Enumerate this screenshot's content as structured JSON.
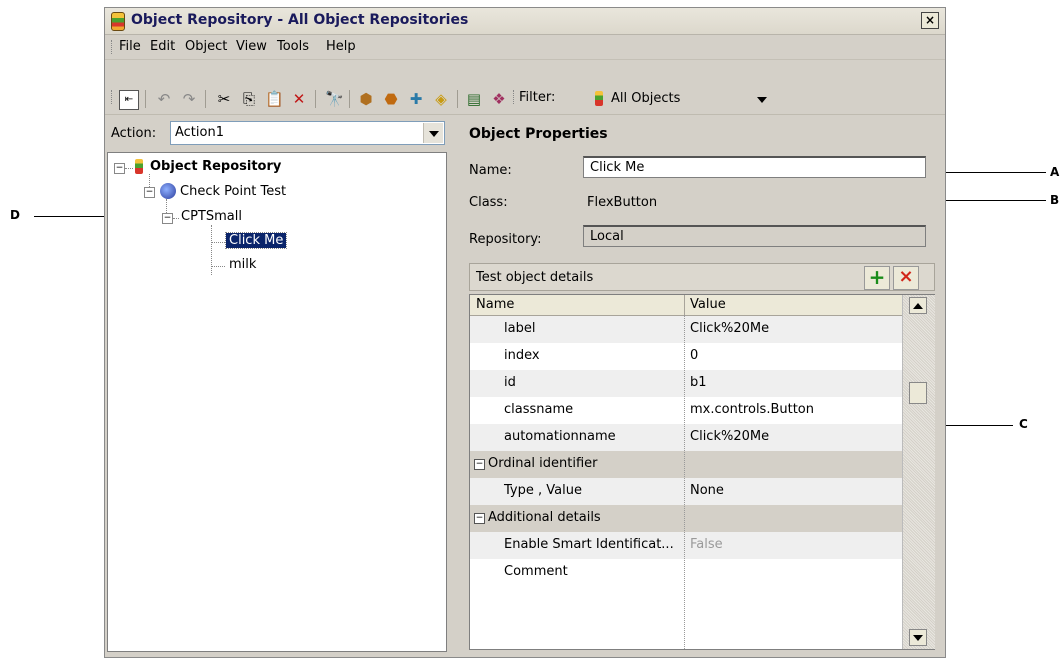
{
  "window": {
    "title": "Object Repository - All Object Repositories",
    "close_glyph": "×"
  },
  "menu": [
    "File",
    "Edit",
    "Object",
    "View",
    "Tools",
    "Help"
  ],
  "toolbar": {
    "filter_label": "Filter:",
    "filter_value": "All Objects"
  },
  "action": {
    "label": "Action:",
    "value": "Action1"
  },
  "tree": {
    "root": "Object Repository",
    "nodes": [
      "Check Point Test",
      "CPTSmall",
      "Click Me",
      "milk"
    ]
  },
  "properties": {
    "title": "Object Properties",
    "name_label": "Name:",
    "name_value": "Click Me",
    "class_label": "Class:",
    "class_value": "FlexButton",
    "repository_label": "Repository:",
    "repository_value": "Local"
  },
  "details": {
    "title": "Test object details",
    "add_glyph": "+",
    "delete_glyph": "×",
    "columns": [
      "Name",
      "Value"
    ],
    "rows": [
      {
        "name": "label",
        "value": "Click%20Me"
      },
      {
        "name": "index",
        "value": "0"
      },
      {
        "name": "id",
        "value": "b1"
      },
      {
        "name": "classname",
        "value": "mx.controls.Button"
      },
      {
        "name": "automationname",
        "value": "Click%20Me"
      },
      {
        "name": "Ordinal identifier",
        "value": ""
      },
      {
        "name": "Type , Value",
        "value": "None"
      },
      {
        "name": "Additional details",
        "value": ""
      },
      {
        "name": "Enable Smart Identificat...",
        "value": "False"
      },
      {
        "name": "Comment",
        "value": ""
      }
    ]
  },
  "callouts": [
    "A",
    "B",
    "C",
    "D"
  ]
}
